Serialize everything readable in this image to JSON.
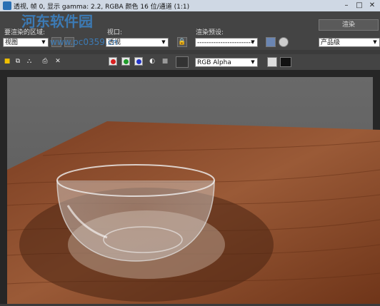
{
  "titlebar": {
    "title": "透视, 帧 0, 显示 gamma: 2.2, RGBA 颜色 16 位/通道 (1:1)"
  },
  "toolbar": {
    "area_label": "要渲染的区域:",
    "area_value": "视图",
    "viewport_label": "视口:",
    "viewport_value": "透视",
    "preset_label": "渲染预设:",
    "preset_value": "------------------------",
    "render_button": "渲染",
    "quality_value": "产品级"
  },
  "row2": {
    "channel_value": "RGB Alpha"
  },
  "watermark": {
    "text": "河东软件园",
    "url": "www.pc0359.cn"
  },
  "colors": {
    "red": "#d71f1f",
    "green": "#1f9b2a",
    "blue": "#2436c9",
    "wood": "#8a4a2a"
  }
}
